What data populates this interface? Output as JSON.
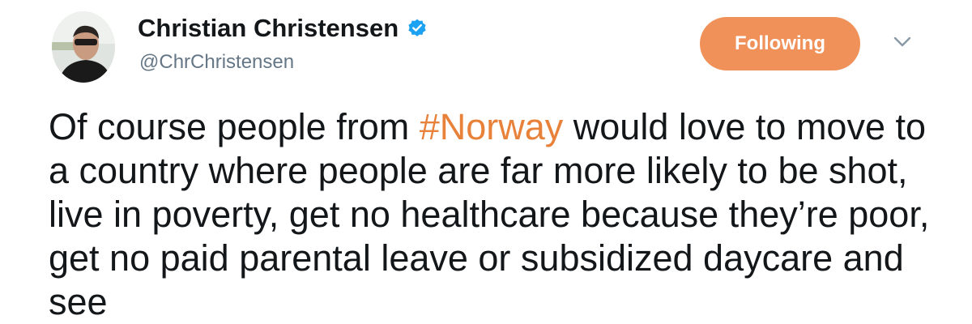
{
  "header": {
    "display_name": "Christian Christensen",
    "handle": "@ChrChristensen",
    "follow_button_label": "Following",
    "verified_icon": "verified-badge-icon",
    "caret_icon": "chevron-down-icon"
  },
  "tweet": {
    "text_before_hashtag": "Of course people from ",
    "hashtag": "#Norway",
    "text_after_hashtag": " would love to move to a country where people are far more likely to be shot, live in poverty, get no healthcare because they’re poor, get no paid parental leave or subsidized daycare and see"
  },
  "colors": {
    "accent": "#f0915a",
    "hashtag": "#e8813a",
    "verified": "#1da1f2",
    "text": "#14171a",
    "muted": "#657786"
  }
}
